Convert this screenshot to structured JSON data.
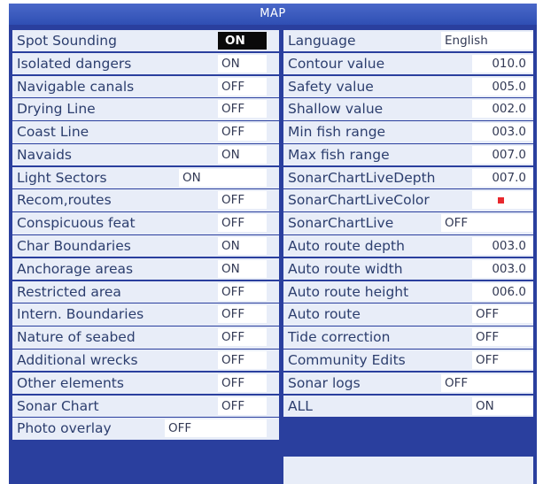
{
  "title": "MAP",
  "left_items": [
    {
      "label": "Spot Sounding",
      "value": "ON"
    },
    {
      "label": "Isolated dangers",
      "value": "ON"
    },
    {
      "label": "Navigable canals",
      "value": "OFF"
    },
    {
      "label": "Drying Line",
      "value": "OFF"
    },
    {
      "label": "Coast Line",
      "value": "OFF"
    },
    {
      "label": "Navaids",
      "value": "ON"
    },
    {
      "label": "Light Sectors",
      "value": "ON"
    },
    {
      "label": "Recom,routes",
      "value": "OFF"
    },
    {
      "label": "Conspicuous feat",
      "value": "OFF"
    },
    {
      "label": "Char Boundaries",
      "value": "ON"
    },
    {
      "label": "Anchorage areas",
      "value": "ON"
    },
    {
      "label": "Restricted area",
      "value": "OFF"
    },
    {
      "label": "Intern. Boundaries",
      "value": "OFF"
    },
    {
      "label": "Nature of seabed",
      "value": "OFF"
    },
    {
      "label": "Additional wrecks",
      "value": "OFF"
    },
    {
      "label": "Other elements",
      "value": "OFF"
    },
    {
      "label": "Sonar Chart",
      "value": "OFF"
    },
    {
      "label": "Photo overlay",
      "value": "OFF"
    }
  ],
  "right_items": [
    {
      "label": "Language",
      "value": "English"
    },
    {
      "label": "Contour value",
      "value": "010.0"
    },
    {
      "label": "Safety value",
      "value": "005.0"
    },
    {
      "label": "Shallow value",
      "value": "002.0"
    },
    {
      "label": "Min fish range",
      "value": "003.0"
    },
    {
      "label": "Max fish range",
      "value": "007.0"
    },
    {
      "label": "SonarChartLiveDepth",
      "value": "007.0"
    },
    {
      "label": "SonarChartLiveColor",
      "value": ""
    },
    {
      "label": "SonarChartLive",
      "value": "OFF"
    },
    {
      "label": "Auto route depth",
      "value": "003.0"
    },
    {
      "label": "Auto route width",
      "value": "003.0"
    },
    {
      "label": "Auto route height",
      "value": "006.0"
    },
    {
      "label": "Auto route",
      "value": "OFF"
    },
    {
      "label": "Tide correction",
      "value": "OFF"
    },
    {
      "label": "Community Edits",
      "value": "OFF"
    },
    {
      "label": "Sonar logs",
      "value": "OFF"
    },
    {
      "label": "ALL",
      "value": "ON"
    }
  ],
  "colors": {
    "frame": "#2a3f9e",
    "row_bg": "#e8edf8",
    "label_text": "#2c3e6e",
    "selected_bg": "#0a0a0a",
    "swatch": "#e8282e"
  },
  "selected": "Spot Sounding"
}
